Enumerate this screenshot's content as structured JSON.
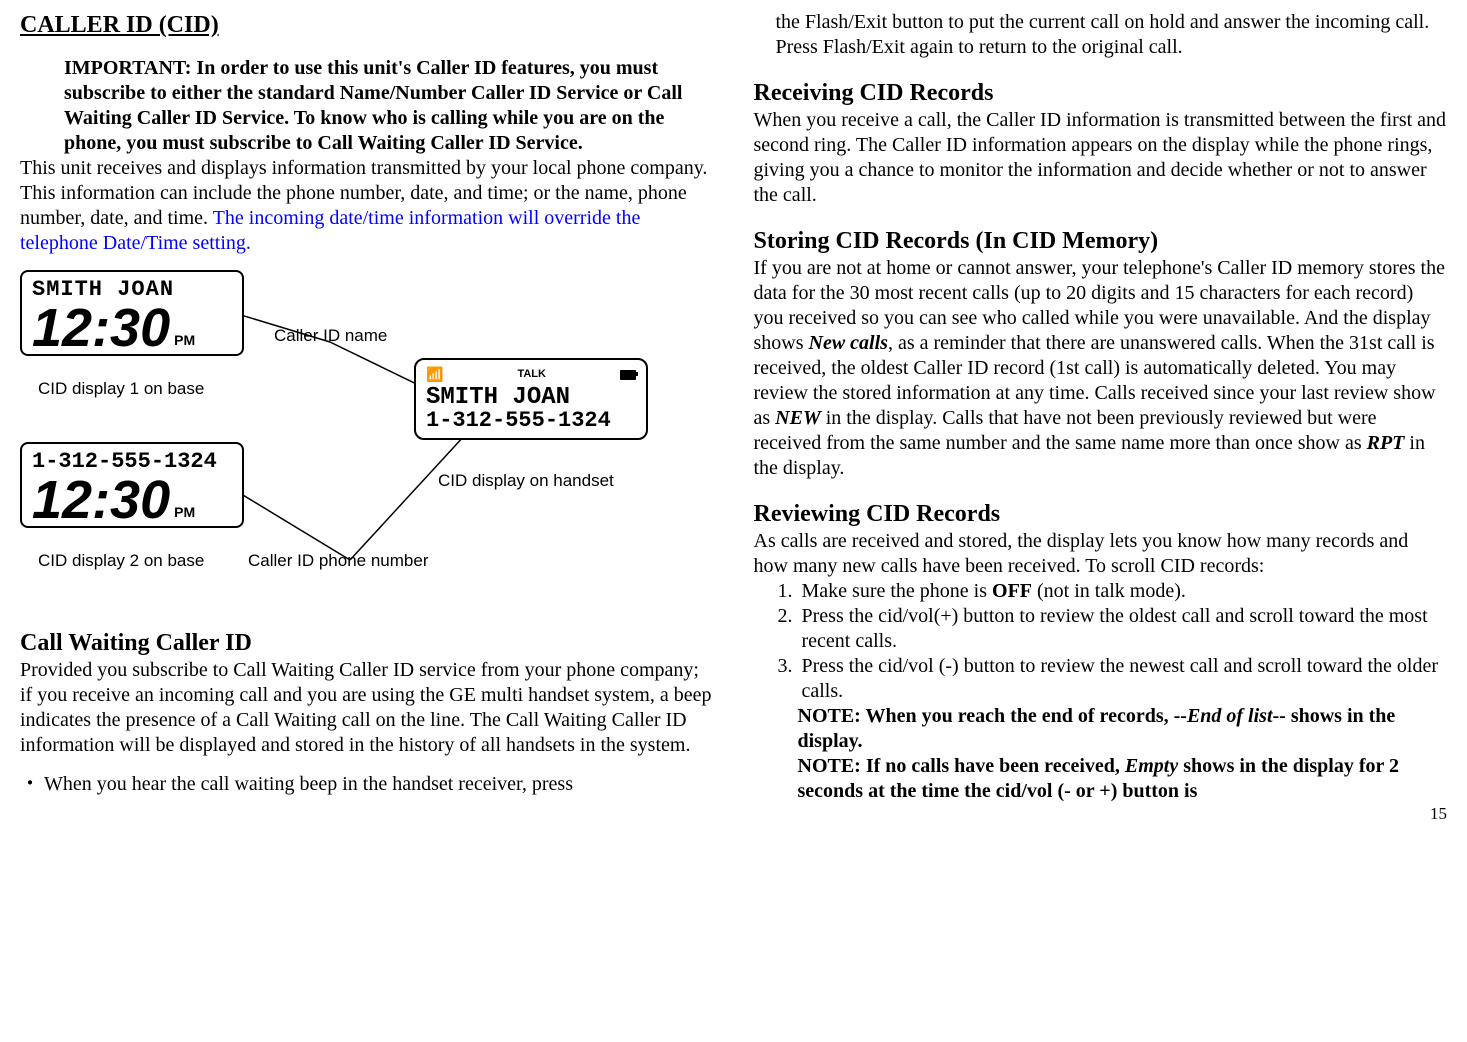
{
  "page_number": "15",
  "left": {
    "title": "CALLER ID (CID)",
    "important": "IMPORTANT: In order to use this unit's Caller ID features, you must subscribe to either the standard Name/Number Caller ID Service or Call Waiting Caller ID Service. To know who is calling while you are on the phone, you must subscribe to Call Waiting Caller ID Service.",
    "para1_black": "This unit receives and displays information transmitted by your local phone company. This information can include the phone number, date, and time; or the name, phone number, date, and time. ",
    "para1_blue": "The incoming date/time information will override the telephone Date/Time setting.",
    "diagram": {
      "lcd1_name": "SMITH JOAN",
      "lcd1_time": "12:30",
      "lcd1_pm": "PM",
      "lcd1_caption": "CID display 1 on base",
      "lcd2_num": "1-312-555-1324",
      "lcd2_time": "12:30",
      "lcd2_pm": "PM",
      "lcd2_caption": "CID display 2 on base",
      "label_cid_name": "Caller ID name",
      "label_cid_phone": "Caller ID phone number",
      "handset_talk": "TALK",
      "handset_name": "SMITH JOAN",
      "handset_num": "1-312-555-1324",
      "handset_caption": "CID display on handset"
    },
    "cwcid_head": "Call Waiting Caller ID",
    "cwcid_body": "Provided you subscribe to Call Waiting Caller ID service from your phone company; if you receive an incoming call and you are using the GE multi handset system, a beep indicates the presence of a Call Waiting call on the line. The Call Waiting Caller ID information will be displayed and stored in the history of all handsets in the system.",
    "bullet_dot": "・",
    "bullet_text": "When you hear the call waiting beep in the handset receiver, press"
  },
  "right": {
    "cont": "the Flash/Exit button to put the current call on hold and answer the incoming call. Press Flash/Exit again to return to the original call.",
    "recv_head": "Receiving CID Records",
    "recv_body": "When you receive a call, the Caller ID information is transmitted between the first and second ring. The Caller ID information appears on the display while the phone rings, giving you a chance to monitor the information and decide whether or not to answer the call.",
    "store_head": "Storing CID Records (In CID Memory)",
    "store_body_a": "If you are not at home or cannot answer, your telephone's Caller ID memory stores the data for the 30 most recent calls (up to 20 digits and 15 characters for each record) you received so you can see who called while you were unavailable. And the display shows ",
    "store_newcalls": "New calls",
    "store_body_b": ", as a reminder that there are unanswered calls. When the 31st call is received, the oldest Caller ID record (1st call) is automatically deleted. You may review the stored information at any time. Calls received since your last review show as ",
    "store_new": "NEW",
    "store_body_c": " in the display. Calls that have not been previously reviewed but were received from the same number and the same name more than once show as ",
    "store_rpt": "RPT",
    "store_body_d": " in the display.",
    "review_head": "Reviewing CID Records",
    "review_intro": "As calls are received and stored, the display lets you know how many records and how many new calls have been received. To scroll CID records:",
    "li1_a": "Make sure the phone is ",
    "li1_off": "OFF",
    "li1_b": " (not in talk mode).",
    "li2": "Press the cid/vol(+) button to review the oldest call and scroll toward the most recent calls.",
    "li3": "Press the cid/vol (-) button to review the newest call and scroll toward the older calls.",
    "note1_a": "NOTE: When you reach the end of records, --",
    "note1_eol": "End of list",
    "note1_b": "-- shows in the display.",
    "note2_a": "NOTE: If no calls have been received, ",
    "note2_empty": "Empty",
    "note2_b": " shows in the display for 2 seconds at the time the cid/vol (- or +) button is"
  }
}
